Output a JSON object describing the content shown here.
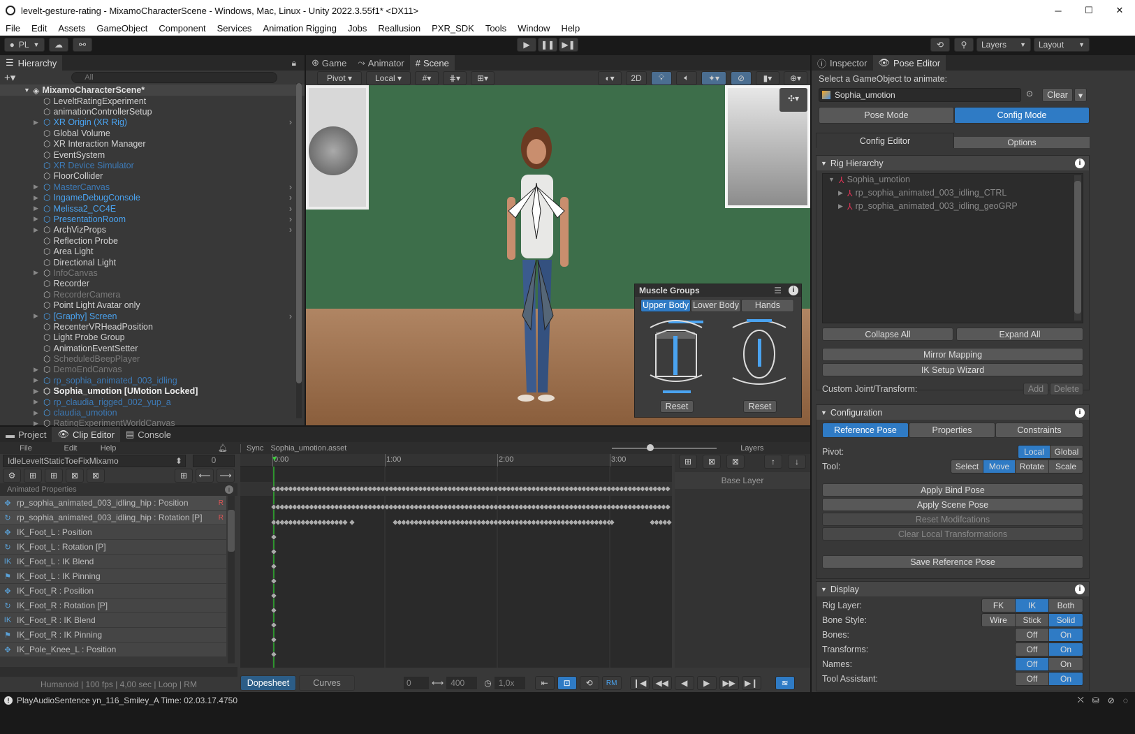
{
  "window": {
    "title": "levelt-gesture-rating - MixamoCharacterScene - Windows, Mac, Linux - Unity 2022.3.55f1* <DX11>",
    "min": "─",
    "max": "☐",
    "close": "✕"
  },
  "menu": [
    "File",
    "Edit",
    "Assets",
    "GameObject",
    "Component",
    "Services",
    "Animation Rigging",
    "Jobs",
    "Reallusion",
    "PXR_SDK",
    "Tools",
    "Window",
    "Help"
  ],
  "toolbar": {
    "account": "PL",
    "layers": "Layers",
    "layout": "Layout"
  },
  "hierarchy": {
    "tab": "Hierarchy",
    "search": "All",
    "scene": "MixamoCharacterScene*",
    "items": [
      {
        "label": "LeveltRatingExperiment",
        "style": "",
        "arrow": ""
      },
      {
        "label": "animationControllerSetup",
        "style": "",
        "arrow": ""
      },
      {
        "label": "XR Origin (XR Rig)",
        "style": "blue",
        "arrow": "▶"
      },
      {
        "label": "Global Volume",
        "style": "",
        "arrow": ""
      },
      {
        "label": "XR Interaction Manager",
        "style": "",
        "arrow": ""
      },
      {
        "label": "EventSystem",
        "style": "",
        "arrow": ""
      },
      {
        "label": "XR Device Simulator",
        "style": "bdim",
        "arrow": ""
      },
      {
        "label": "FloorCollider",
        "style": "",
        "arrow": ""
      },
      {
        "label": "MasterCanvas",
        "style": "bdim",
        "arrow": "▶"
      },
      {
        "label": "IngameDebugConsole",
        "style": "blue",
        "arrow": "▶"
      },
      {
        "label": "Melissa2_CC4E",
        "style": "blue",
        "arrow": "▶"
      },
      {
        "label": "PresentationRoom",
        "style": "blue",
        "arrow": "▶"
      },
      {
        "label": "ArchVizProps",
        "style": "",
        "arrow": "▶"
      },
      {
        "label": "Reflection Probe",
        "style": "",
        "arrow": ""
      },
      {
        "label": "Area Light",
        "style": "",
        "arrow": ""
      },
      {
        "label": "Directional Light",
        "style": "",
        "arrow": ""
      },
      {
        "label": "InfoCanvas",
        "style": "dim",
        "arrow": "▶"
      },
      {
        "label": "Recorder",
        "style": "",
        "arrow": ""
      },
      {
        "label": "RecorderCamera",
        "style": "dim",
        "arrow": ""
      },
      {
        "label": "Point Light Avatar only",
        "style": "",
        "arrow": ""
      },
      {
        "label": "[Graphy] Screen",
        "style": "blue",
        "arrow": "▶"
      },
      {
        "label": "RecenterVRHeadPosition",
        "style": "",
        "arrow": ""
      },
      {
        "label": "Light Probe Group",
        "style": "",
        "arrow": ""
      },
      {
        "label": "AnimationEventSetter",
        "style": "",
        "arrow": ""
      },
      {
        "label": "ScheduledBeepPlayer",
        "style": "dim",
        "arrow": ""
      },
      {
        "label": "DemoEndCanvas",
        "style": "dim",
        "arrow": "▶"
      },
      {
        "label": "rp_sophia_animated_003_idling",
        "style": "bdim",
        "arrow": "▶"
      },
      {
        "label": "Sophia_umotion [UMotion Locked]",
        "style": "bold",
        "arrow": "▶"
      },
      {
        "label": "rp_claudia_rigged_002_yup_a",
        "style": "bdim",
        "arrow": "▶"
      },
      {
        "label": "claudia_umotion",
        "style": "bdim",
        "arrow": "▶"
      },
      {
        "label": "RatingExperimentWorldCanvas",
        "style": "dim",
        "arrow": "▶"
      }
    ]
  },
  "scene": {
    "tabs": [
      "Game",
      "Animator",
      "Scene"
    ],
    "pivot": "Pivot",
    "local": "Local",
    "mode2d": "2D"
  },
  "muscle": {
    "title": "Muscle Groups",
    "tabs": [
      "Upper Body",
      "Lower Body",
      "Hands"
    ],
    "reset": "Reset"
  },
  "inspector": {
    "tabs": [
      "Inspector",
      "Pose Editor"
    ],
    "select_label": "Select a GameObject to animate:",
    "object": "Sophia_umotion",
    "clear": "Clear",
    "modes": [
      "Pose Mode",
      "Config Mode"
    ],
    "subtabs": [
      "Config Editor",
      "Options"
    ],
    "rig_hierarchy": "Rig Hierarchy",
    "rig_items": [
      "Sophia_umotion",
      "rp_sophia_animated_003_idling_CTRL",
      "rp_sophia_animated_003_idling_geoGRP"
    ],
    "collapse": "Collapse All",
    "expand": "Expand All",
    "mirror": "Mirror Mapping",
    "ik_wizard": "IK Setup Wizard",
    "custom_joint": "Custom Joint/Transform:",
    "add": "Add",
    "delete": "Delete",
    "configuration": "Configuration",
    "config_tabs": [
      "Reference Pose",
      "Properties",
      "Constraints"
    ],
    "pivot_label": "Pivot:",
    "pivot_opts": [
      "Local",
      "Global"
    ],
    "tool_label": "Tool:",
    "tool_opts": [
      "Select",
      "Move",
      "Rotate",
      "Scale"
    ],
    "apply_bind": "Apply Bind Pose",
    "apply_scene": "Apply Scene Pose",
    "reset_mod": "Reset Modifcations",
    "clear_local": "Clear Local Transformations",
    "save_ref": "Save Reference Pose",
    "display": "Display",
    "display_rows": [
      {
        "label": "Rig Layer:",
        "opts": [
          "FK",
          "IK",
          "Both"
        ],
        "sel": 1
      },
      {
        "label": "Bone Style:",
        "opts": [
          "Wire",
          "Stick",
          "Solid"
        ],
        "sel": 2
      },
      {
        "label": "Bones:",
        "opts": [
          "Off",
          "On"
        ],
        "sel": 1
      },
      {
        "label": "Transforms:",
        "opts": [
          "Off",
          "On"
        ],
        "sel": 1
      },
      {
        "label": "Names:",
        "opts": [
          "Off",
          "On"
        ],
        "sel": 0
      },
      {
        "label": "Tool Assistant:",
        "opts": [
          "Off",
          "On"
        ],
        "sel": 1
      }
    ]
  },
  "bottom": {
    "tabs": [
      "Project",
      "Clip Editor",
      "Console"
    ],
    "file": "File",
    "edit": "Edit",
    "help": "Help",
    "sync": "Sync",
    "clip_asset": "Sophia_umotion.asset",
    "layers": "Layers",
    "base_layer": "Base Layer",
    "clip_name": "IdleLeveltStaticToeFixMixamo",
    "clip_frame": "0",
    "animated_props": "Animated Properties",
    "props": [
      {
        "label": "rp_sophia_animated_003_idling_hip : Position",
        "icon": "✥"
      },
      {
        "label": "rp_sophia_animated_003_idling_hip : Rotation [P]",
        "icon": "↻"
      },
      {
        "label": "IK_Foot_L : Position",
        "icon": "✥"
      },
      {
        "label": "IK_Foot_L : Rotation [P]",
        "icon": "↻"
      },
      {
        "label": "IK_Foot_L : IK Blend",
        "icon": "IK"
      },
      {
        "label": "IK_Foot_L : IK Pinning",
        "icon": "⚑"
      },
      {
        "label": "IK_Foot_R : Position",
        "icon": "✥"
      },
      {
        "label": "IK_Foot_R : Rotation [P]",
        "icon": "↻"
      },
      {
        "label": "IK_Foot_R : IK Blend",
        "icon": "IK"
      },
      {
        "label": "IK_Foot_R : IK Pinning",
        "icon": "⚑"
      },
      {
        "label": "IK_Pole_Knee_L : Position",
        "icon": "✥"
      }
    ],
    "times": [
      "0:00",
      "1:00",
      "2:00",
      "3:00"
    ],
    "info": "Humanoid | 100 fps | 4,00 sec | Loop | RM",
    "dopesheet": "Dopesheet",
    "curves": "Curves",
    "frame_start": "0",
    "frame_end": "400",
    "speed": "1,0x",
    "rm": "RM"
  },
  "status": "PlayAudioSentence yn_116_Smiley_A Time: 02.03.17.4750"
}
